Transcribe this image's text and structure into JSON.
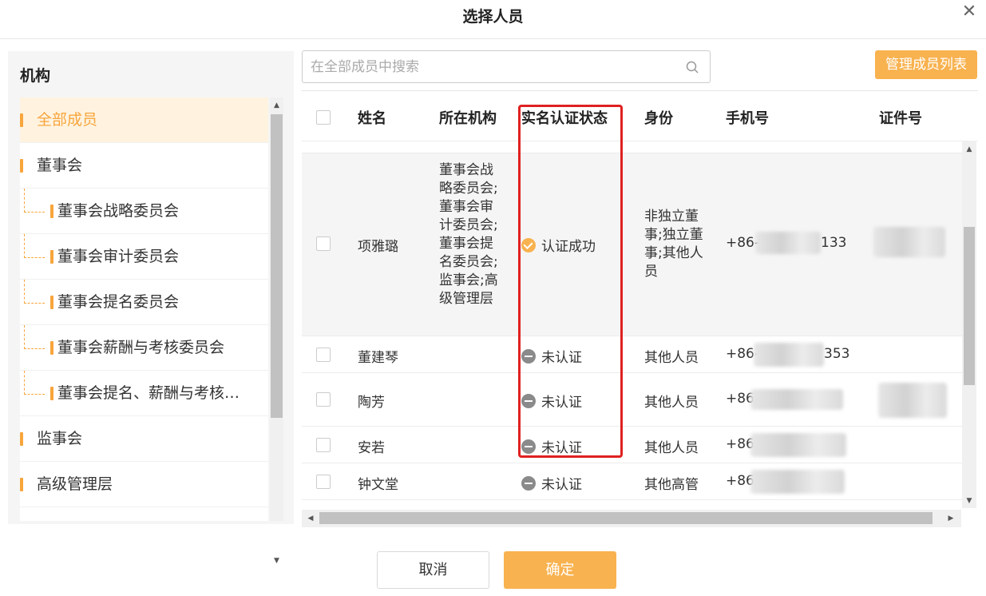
{
  "dialog": {
    "title": "选择人员",
    "close_icon": "close-icon"
  },
  "sidebar": {
    "title": "机构",
    "items": [
      {
        "label": "全部成员",
        "active": true,
        "level": 0
      },
      {
        "label": "董事会",
        "active": false,
        "level": 0
      },
      {
        "label": "董事会战略委员会",
        "active": false,
        "level": 1
      },
      {
        "label": "董事会审计委员会",
        "active": false,
        "level": 1
      },
      {
        "label": "董事会提名委员会",
        "active": false,
        "level": 1
      },
      {
        "label": "董事会薪酬与考核委员会",
        "active": false,
        "level": 1
      },
      {
        "label": "董事会提名、薪酬与考核…",
        "active": false,
        "level": 1
      },
      {
        "label": "监事会",
        "active": false,
        "level": 0
      },
      {
        "label": "高级管理层",
        "active": false,
        "level": 0
      }
    ]
  },
  "search": {
    "placeholder": "在全部成员中搜索",
    "value": ""
  },
  "toolbar": {
    "manage_label": "管理成员列表"
  },
  "table": {
    "headers": {
      "name": "姓名",
      "org": "所在机构",
      "status": "实名认证状态",
      "role": "身份",
      "phone": "手机号",
      "idno": "证件号"
    },
    "rows": [
      {
        "name": "项雅璐",
        "org": "董事会战略委员会;董事会审计委员会;董事会提名委员会;监事会;高级管理层",
        "status": "认证成功",
        "status_type": "ok",
        "role": "非独立董事;独立董事;其他人员",
        "phone_prefix": "+86-",
        "phone_suffix": "133",
        "highlighted": true
      },
      {
        "name": "董建琴",
        "org": "",
        "status": "未认证",
        "status_type": "no",
        "role": "其他人员",
        "phone_prefix": "+86-",
        "phone_suffix": "353",
        "highlighted": false
      },
      {
        "name": "陶芳",
        "org": "",
        "status": "未认证",
        "status_type": "no",
        "role": "其他人员",
        "phone_prefix": "+86",
        "phone_suffix": "",
        "highlighted": false
      },
      {
        "name": "安若",
        "org": "",
        "status": "未认证",
        "status_type": "no",
        "role": "其他人员",
        "phone_prefix": "+86",
        "phone_suffix": "",
        "highlighted": false
      },
      {
        "name": "钟文堂",
        "org": "",
        "status": "未认证",
        "status_type": "no",
        "role": "其他高管",
        "phone_prefix": "+86",
        "phone_suffix": "",
        "highlighted": false
      }
    ]
  },
  "footer": {
    "cancel_label": "取消",
    "ok_label": "确定"
  },
  "colors": {
    "accent": "#f8b24f",
    "highlight_box": "#e02020"
  }
}
